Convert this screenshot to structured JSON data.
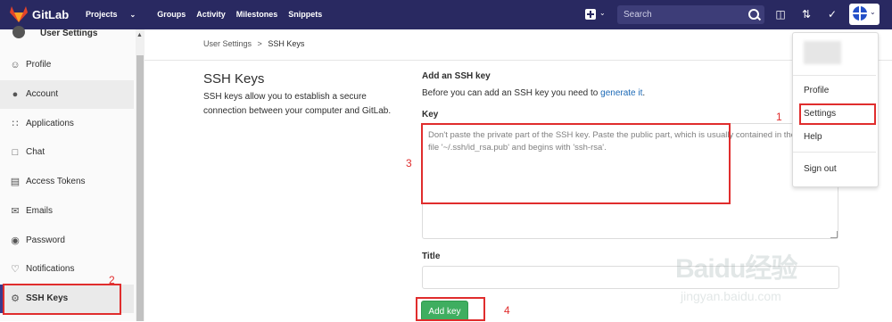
{
  "nav": {
    "brand": "GitLab",
    "links": [
      "Projects",
      "Groups",
      "Activity",
      "Milestones",
      "Snippets"
    ],
    "search_placeholder": "Search"
  },
  "sidebar": {
    "header": "User Settings",
    "items": [
      {
        "label": "Profile",
        "icon": "user-circle-icon"
      },
      {
        "label": "Account",
        "icon": "users-icon"
      },
      {
        "label": "Applications",
        "icon": "grid-icon"
      },
      {
        "label": "Chat",
        "icon": "chat-icon"
      },
      {
        "label": "Access Tokens",
        "icon": "token-icon"
      },
      {
        "label": "Emails",
        "icon": "envelope-icon"
      },
      {
        "label": "Password",
        "icon": "lock-icon"
      },
      {
        "label": "Notifications",
        "icon": "bell-icon"
      },
      {
        "label": "SSH Keys",
        "icon": "key-icon"
      }
    ]
  },
  "breadcrumb": {
    "parent": "User Settings",
    "separator": ">",
    "current": "SSH Keys"
  },
  "section": {
    "title": "SSH Keys",
    "description": "SSH keys allow you to establish a secure connection between your computer and GitLab."
  },
  "form": {
    "title": "Add an SSH key",
    "intro_prefix": "Before you can add an SSH key you need to ",
    "intro_link": "generate it",
    "intro_suffix": ".",
    "key_label": "Key",
    "key_placeholder_line1": "Don't paste the private part of the SSH key. Paste the public part, which is usually contained in the",
    "key_placeholder_line2": "file '~/.ssh/id_rsa.pub' and begins with 'ssh-rsa'.",
    "title_label": "Title",
    "submit_label": "Add key"
  },
  "dropdown": {
    "items": [
      "Profile",
      "Settings",
      "Help",
      "Sign out"
    ]
  },
  "annotations": [
    "1",
    "2",
    "3",
    "4"
  ],
  "watermark": {
    "text": "Baidu经验",
    "sub": "jingyan.baidu.com"
  },
  "colors": {
    "nav_bg": "#292961",
    "button_green": "#3fae60",
    "annotation_red": "#e02d2d",
    "link": "#1b69b6"
  }
}
